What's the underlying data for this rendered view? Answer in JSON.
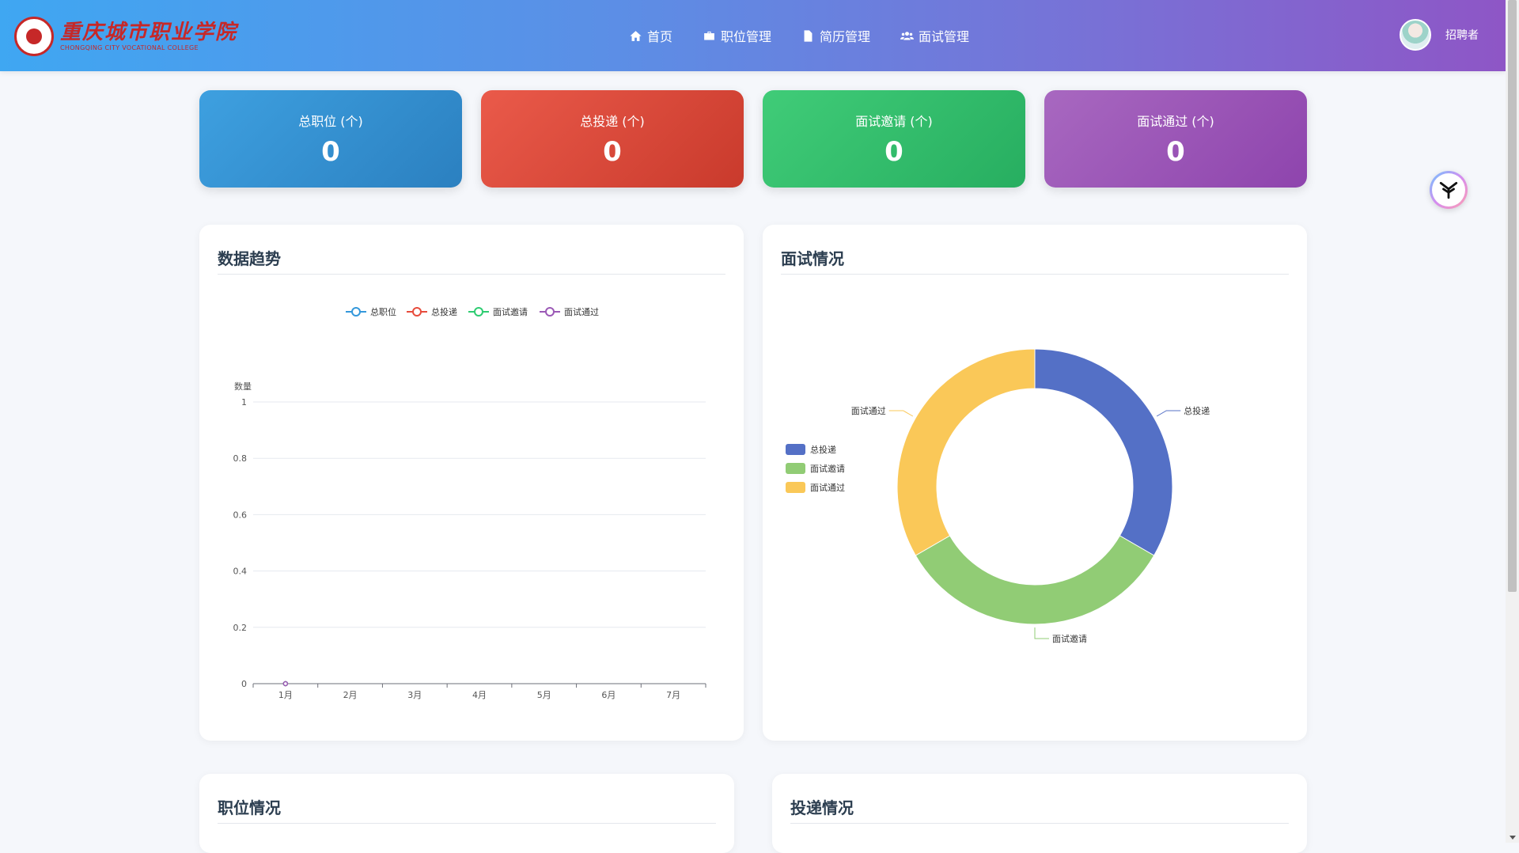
{
  "header": {
    "logo_cn": "重庆城市职业学院",
    "logo_en": "CHONGQING CITY VOCATIONAL COLLEGE",
    "nav": [
      {
        "label": "首页",
        "icon": "home-icon"
      },
      {
        "label": "职位管理",
        "icon": "briefcase-icon"
      },
      {
        "label": "简历管理",
        "icon": "document-icon"
      },
      {
        "label": "面试管理",
        "icon": "users-icon"
      }
    ],
    "user_name": "招聘者"
  },
  "stats": [
    {
      "label": "总职位 (个)",
      "value": "0",
      "color": "#3498db"
    },
    {
      "label": "总投递 (个)",
      "value": "0",
      "color": "#e74c3c"
    },
    {
      "label": "面试邀请 (个)",
      "value": "0",
      "color": "#2ecc71"
    },
    {
      "label": "面试通过 (个)",
      "value": "0",
      "color": "#9b59b6"
    }
  ],
  "panels": {
    "trend_title": "数据趋势",
    "pie_title": "面试情况",
    "job_title": "职位情况",
    "apply_title": "投递情况"
  },
  "chart_data": [
    {
      "type": "line",
      "title": "",
      "ylabel": "数量",
      "xlabel": "",
      "categories": [
        "1月",
        "2月",
        "3月",
        "4月",
        "5月",
        "6月",
        "7月"
      ],
      "ylim": [
        0,
        1
      ],
      "yticks": [
        "0",
        "0.2",
        "0.4",
        "0.6",
        "0.8",
        "1"
      ],
      "grid": true,
      "legend_position": "top",
      "series": [
        {
          "name": "总职位",
          "color": "#3498db",
          "values": [
            0
          ]
        },
        {
          "name": "总投递",
          "color": "#e74c3c",
          "values": [
            0
          ]
        },
        {
          "name": "面试邀请",
          "color": "#2ecc71",
          "values": [
            0
          ]
        },
        {
          "name": "面试通过",
          "color": "#9b59b6",
          "values": [
            0
          ]
        }
      ]
    },
    {
      "type": "pie",
      "title": "",
      "donut": true,
      "legend_position": "left",
      "slices": [
        {
          "name": "总投递",
          "value": 1,
          "color": "#5470c6"
        },
        {
          "name": "面试邀请",
          "value": 1,
          "color": "#91cc75"
        },
        {
          "name": "面试通过",
          "value": 1,
          "color": "#fac858"
        }
      ]
    }
  ]
}
